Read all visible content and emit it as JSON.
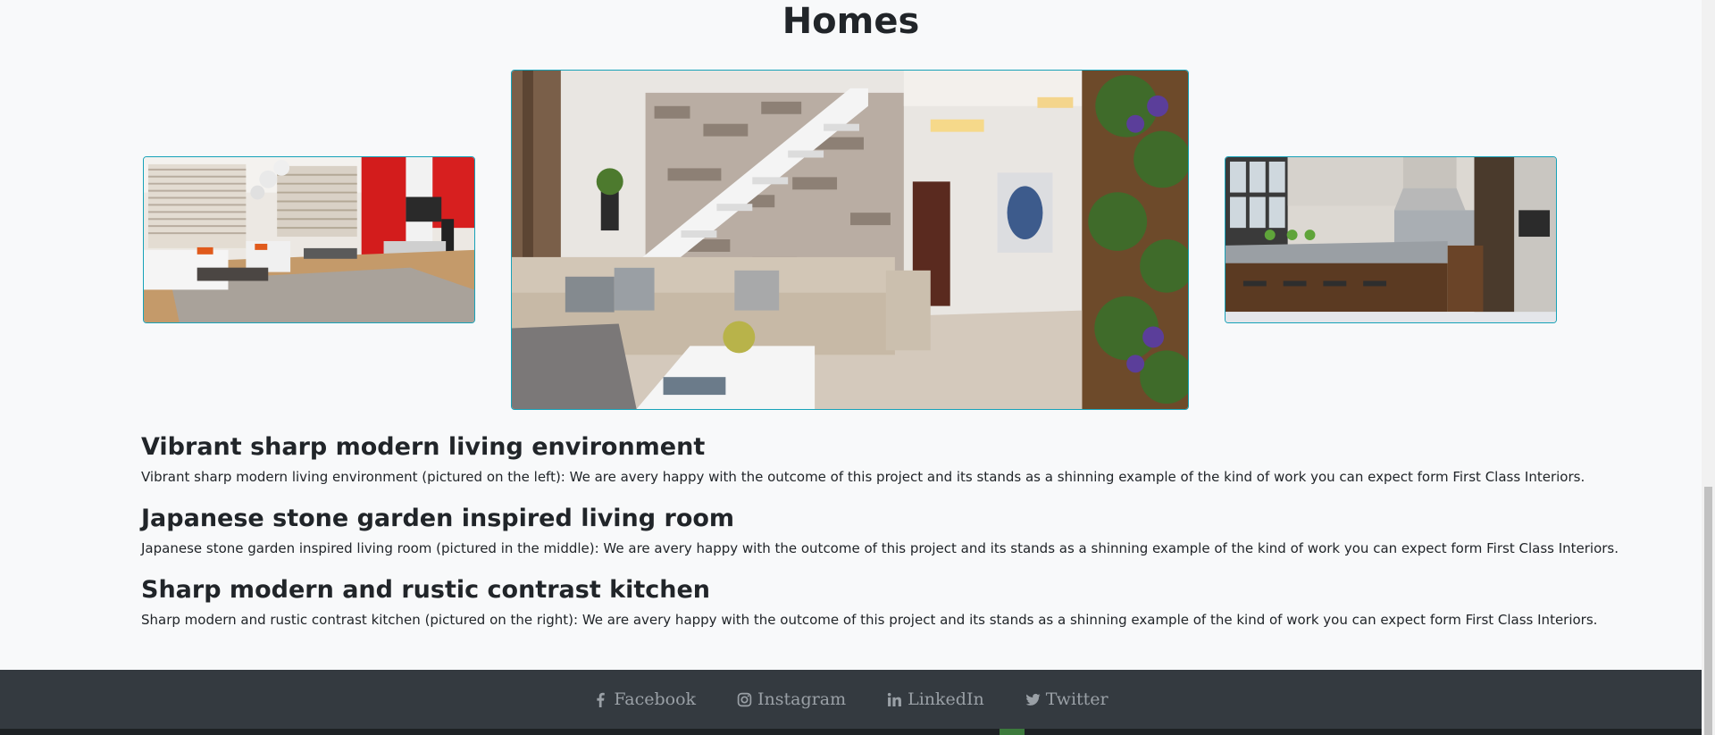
{
  "section": {
    "title": "Homes"
  },
  "gallery": {
    "left": {
      "alt": "Vibrant sharp modern living environment"
    },
    "middle": {
      "alt": "Japanese stone garden inspired living room"
    },
    "right": {
      "alt": "Sharp modern and rustic contrast kitchen"
    },
    "border_color": "#17a2b8"
  },
  "projects": [
    {
      "title": "Vibrant sharp modern living environment",
      "text": "Vibrant sharp modern living environment (pictured on the left): We are avery happy with the outcome of this project and its stands as a shinning example of the kind of work you can expect form First Class Interiors."
    },
    {
      "title": "Japanese stone garden inspired living room",
      "text": "Japanese stone garden inspired living room (pictured in the middle): We are avery happy with the outcome of this project and its stands as a shinning example of the kind of work you can expect form First Class Interiors."
    },
    {
      "title": "Sharp modern and rustic contrast kitchen",
      "text": "Sharp modern and rustic contrast kitchen (pictured on the right): We are avery happy with the outcome of this project and its stands as a shinning example of the kind of work you can expect form First Class Interiors."
    }
  ],
  "footer": {
    "links": [
      {
        "label": "Facebook",
        "icon": "facebook-icon"
      },
      {
        "label": "Instagram",
        "icon": "instagram-icon"
      },
      {
        "label": "LinkedIn",
        "icon": "linkedin-icon"
      },
      {
        "label": "Twitter",
        "icon": "twitter-icon"
      }
    ],
    "background": "#343a40"
  }
}
